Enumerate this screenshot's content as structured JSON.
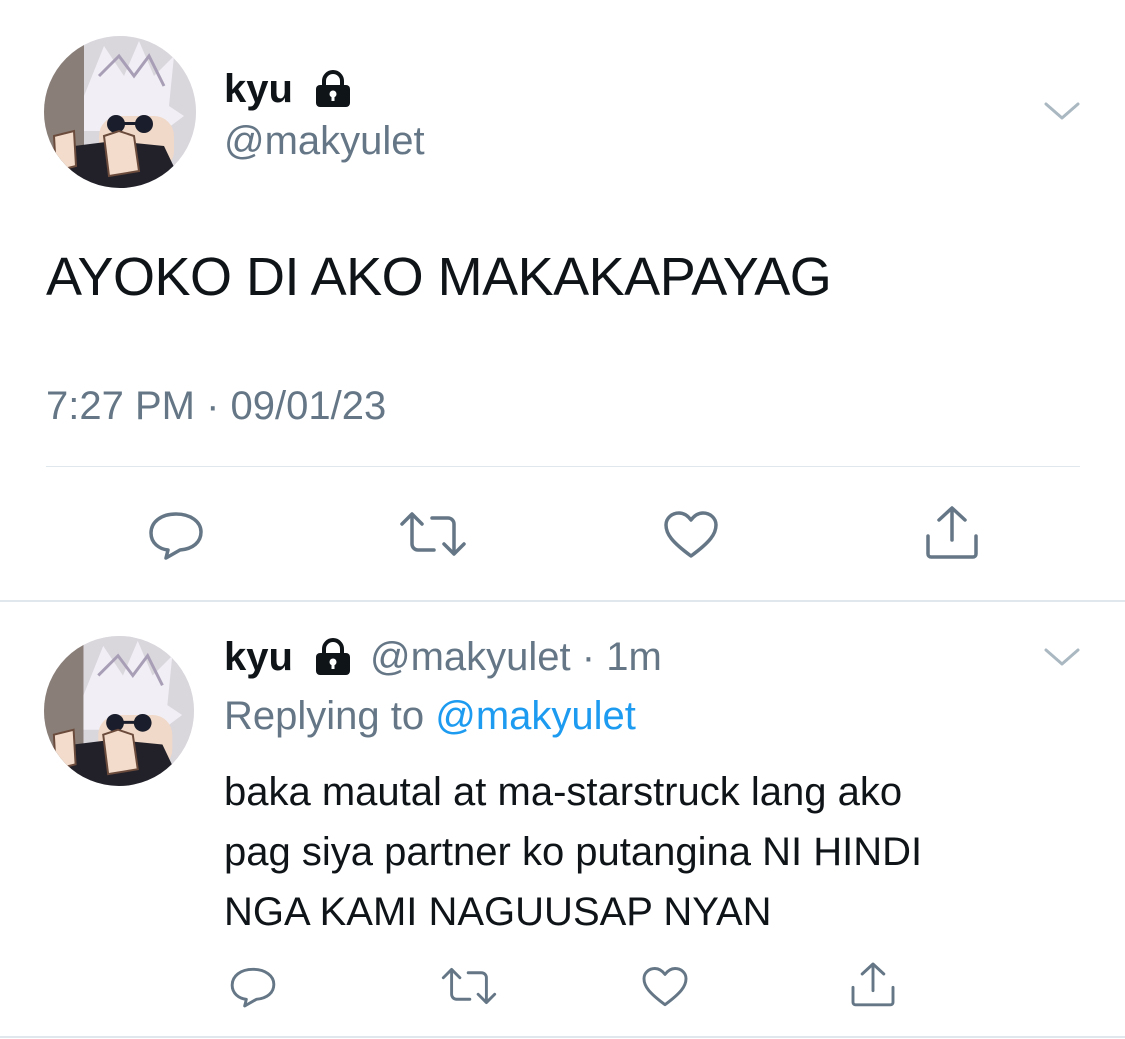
{
  "main_tweet": {
    "display_name": "kyu",
    "handle": "@makyulet",
    "text": "AYOKO DI AKO MAKAKAPAYAG",
    "timestamp": "7:27 PM · 09/01/23",
    "icons": {
      "lock": "lock-icon",
      "menu": "chevron-down-icon",
      "actions": [
        "reply-icon",
        "retweet-icon",
        "like-icon",
        "share-icon"
      ]
    }
  },
  "reply_tweet": {
    "display_name": "kyu",
    "handle": "@makyulet",
    "separator": "·",
    "time_ago": "1m",
    "replying_label": "Replying to",
    "replying_handle": "@makyulet",
    "text_lines": [
      "baka mautal at ma-starstruck lang ako",
      "pag siya partner ko putangina NI HINDI",
      "NGA KAMI NAGUUSAP NYAN"
    ],
    "icons": {
      "lock": "lock-icon",
      "menu": "chevron-down-icon",
      "actions": [
        "reply-icon",
        "retweet-icon",
        "like-icon",
        "share-icon"
      ]
    }
  },
  "colors": {
    "text": "#0f1419",
    "secondary": "#657786",
    "link": "#1d9bf0",
    "divider": "#e1e8ed"
  }
}
